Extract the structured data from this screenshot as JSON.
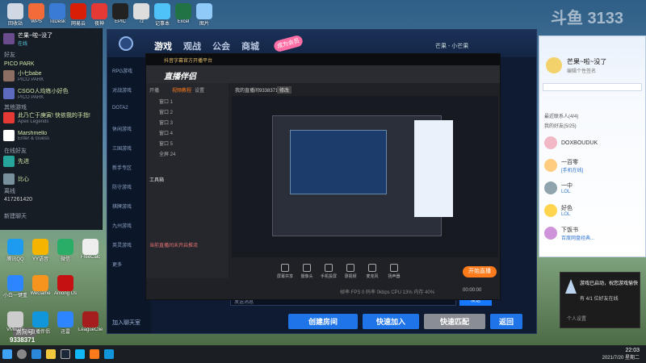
{
  "colors": {
    "accent_blue": "#1677ff",
    "game_orange": "#ff7a1a",
    "steam_green": "#cfe8a9",
    "qq_blue": "#12b7f5"
  },
  "watermark": "斗鱼 3133",
  "room": {
    "badge": "房间号",
    "number": "9338371"
  },
  "steam": {
    "user_name": "芒果~啦~没了",
    "user_status": "在线",
    "friends_label": "好友",
    "game_section": "PICO PARK",
    "game_friends": [
      {
        "name": "小七babe",
        "sub": "PICO PARK"
      },
      {
        "name": "CSGO人均练小好色",
        "sub": "PICO PARK"
      }
    ],
    "other_section": "其他游戏",
    "other_friends": [
      {
        "name": "此乃亡于庚寅! 快依我的手指!",
        "sub": "Apex Legends"
      },
      {
        "name": "Marshmello",
        "sub": "Enter & Guess"
      }
    ],
    "online_section": "在线好友",
    "online_friends": [
      {
        "name": "先进"
      },
      {
        "name": "比心"
      }
    ],
    "offline_section": "离线",
    "offline_id": "417261420",
    "group_label": "新建聊天"
  },
  "desktop_icons": [
    {
      "label": "腾讯QQ",
      "color": "#1d9bf0"
    },
    {
      "label": "YY语音",
      "color": "#f5b400"
    },
    {
      "label": "微信",
      "color": "#2aae67"
    },
    {
      "label": "FreeCalc",
      "color": "#eeeeee"
    },
    {
      "label": "小白一键重装",
      "color": "#2d86ff"
    },
    {
      "label": "WeGame",
      "color": "#f7941d"
    },
    {
      "label": "Among Us",
      "color": "#c51111"
    },
    {
      "label": "VMware",
      "color": "#cccccc"
    },
    {
      "label": "直播伴侣",
      "color": "#1296db"
    },
    {
      "label": "迅雷",
      "color": "#2d86ff"
    },
    {
      "label": "LeagueClient",
      "color": "#a51d1d"
    }
  ],
  "top_icons": [
    {
      "label": "回收站",
      "color": "#cfd8e3"
    },
    {
      "label": "WPS",
      "color": "#f26b38"
    },
    {
      "label": "ToDesk",
      "color": "#3a7bd5"
    },
    {
      "label": "网易云",
      "color": "#d81e06"
    },
    {
      "label": "夜神",
      "color": "#e53935"
    },
    {
      "label": "EPIC",
      "color": "#222222"
    },
    {
      "label": "7z",
      "color": "#dddddd"
    },
    {
      "label": "记事本",
      "color": "#4fc3f7"
    },
    {
      "label": "Excel",
      "color": "#217346"
    },
    {
      "label": "图片",
      "color": "#90caf9"
    }
  ],
  "game": {
    "tabs": [
      "游戏",
      "观战",
      "公会",
      "商城"
    ],
    "sidebar": [
      "RPG游戏",
      "对战游戏",
      "DOTA2",
      "休闲游戏",
      "三国游戏",
      "新手专区",
      "防守游戏",
      "棋牌游戏",
      "九州游戏",
      "英灵游戏",
      "更多"
    ],
    "user_label": "芒果 - 小芒果",
    "recharge_label": "成为会员",
    "btn_create": "创建房间",
    "btn_quick_join": "快速加入",
    "btn_quick_match": "快速匹配",
    "btn_back": "返回",
    "friend_add": "加入聊天室"
  },
  "stream": {
    "brand": "直播伴侣",
    "title": "抖音字幕官方开播平台",
    "left_tabs": [
      "开播",
      "视频教程",
      "设置"
    ],
    "scenes": [
      "窗口 1",
      "窗口 2",
      "窗口 3",
      "窗口 4",
      "窗口 5",
      "全屏 24"
    ],
    "tools_label": "工具箱",
    "room_title": "我的直播间9338371",
    "edit_label": "修改",
    "tools": [
      "屏幕共享",
      "摄像头",
      "手机投屏",
      "录视频",
      "麦克风",
      "扬声器"
    ],
    "start_btn": "开始直播",
    "timer": "00:00:00",
    "notice": "当前直播间未开启推流",
    "stats": "帧率 FPS 0  码率 0kbps  CPU 13%  内存 40%"
  },
  "chat_input_placeholder": "发送消息",
  "send_btn": "发送",
  "qq": {
    "name": "芒果~啦~没了",
    "sign": "编辑个性签名",
    "section_recent": "最近联系人(4/4)",
    "section_friends": "我的好友(5/25)",
    "contacts": [
      {
        "name": "DOXBOUDUK",
        "sub": "",
        "color": "#f2b8c6"
      },
      {
        "name": "一百零",
        "sub": "[手机在线]",
        "color": "#ffcc80"
      },
      {
        "name": "一中",
        "sub": "LOL",
        "color": "#90a4ae"
      },
      {
        "name": "好色",
        "sub": "LOL",
        "color": "#ffd54f"
      },
      {
        "name": "下饭书",
        "sub": "百度网盘经典...",
        "color": "#ce93d8"
      }
    ]
  },
  "notif": {
    "title": "游戏已启动，祝您游戏愉快",
    "line2": "有 4/1 位好友在线",
    "sub": "个人设置"
  },
  "clock": {
    "time": "22:03",
    "date": "2021/7/20 星期二"
  }
}
